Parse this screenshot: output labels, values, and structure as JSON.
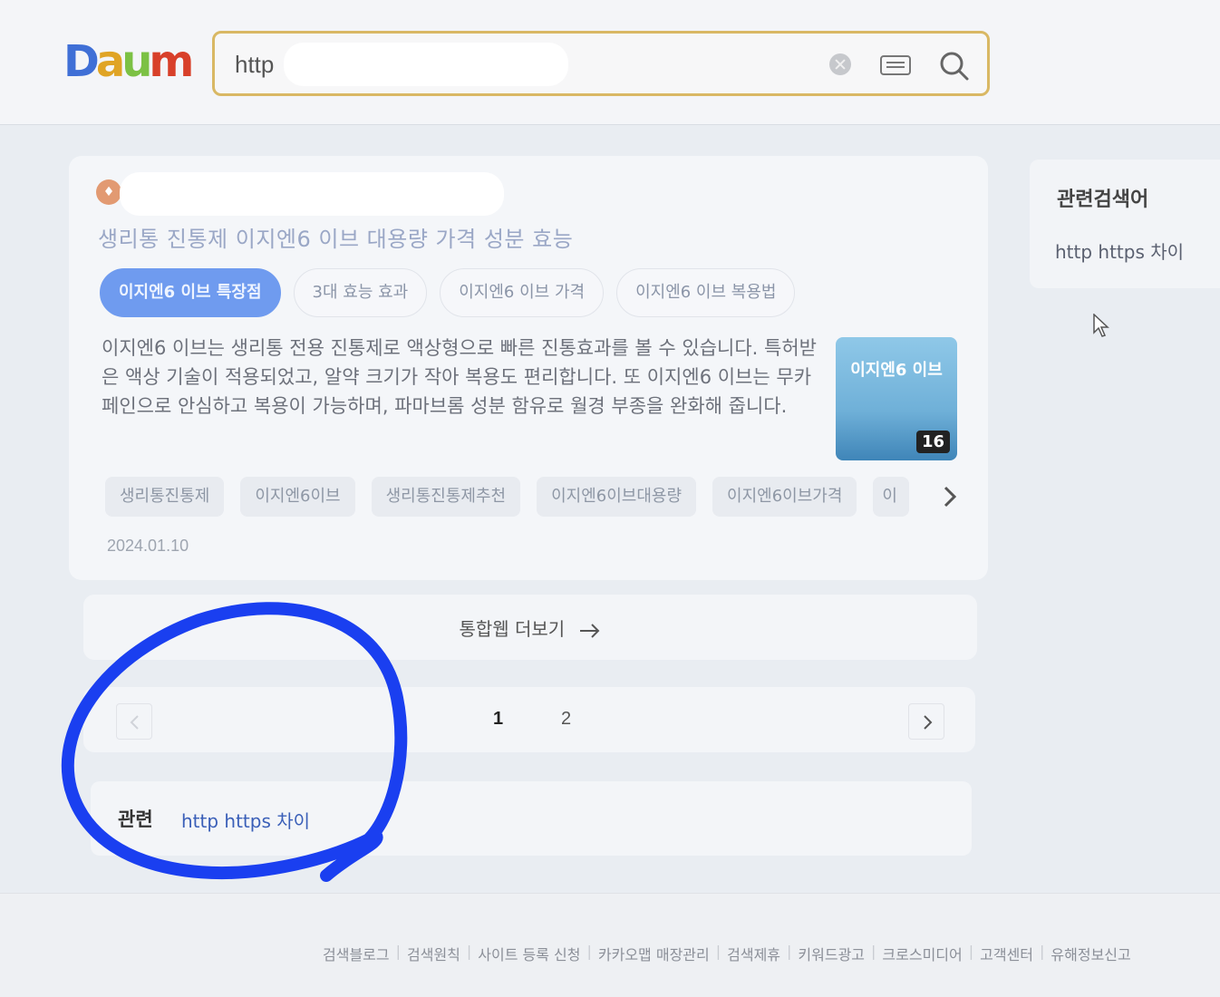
{
  "header": {
    "logo": [
      "D",
      "a",
      "u",
      "m"
    ],
    "search": {
      "value": "http"
    }
  },
  "result": {
    "title": "생리통 진통제 이지엔6 이브 대용량 가격 성분 효능",
    "chips": [
      "이지엔6 이브 특장점",
      "3대 효능 효과",
      "이지엔6 이브 가격",
      "이지엔6 이브 복용법"
    ],
    "active_chip": 0,
    "snippet": "이지엔6 이브는 생리통 전용 진통제로 액상형으로 빠른 진통효과를 볼 수 있습니다. 특허받은 액상 기술이 적용되었고, 알약 크기가 작아 복용도 편리합니다. 또 이지엔6 이브는 무카페인으로 안심하고 복용이 가능하며, 파마브롬 성분 함유로 월경 부종을 완화해 줍니다.",
    "thumbnail": {
      "title": "이지엔6 이브",
      "count": "16"
    },
    "tags": [
      "생리통진통제",
      "이지엔6이브",
      "생리통진통제추천",
      "이지엔6이브대용량",
      "이지엔6이브가격",
      "이"
    ],
    "date": "2024.01.10"
  },
  "more_results": {
    "label": "통합웹 더보기"
  },
  "pagination": {
    "pages": [
      "1",
      "2"
    ],
    "current": "1"
  },
  "related_bottom": {
    "label": "관련",
    "link": "http https 차이"
  },
  "sidebar": {
    "title": "관련검색어",
    "items": [
      "http https 차이"
    ]
  },
  "footer": {
    "links": [
      "검색블로그",
      "검색원칙",
      "사이트 등록 신청",
      "카카오맵 매장관리",
      "검색제휴",
      "키워드광고",
      "크로스미디어",
      "고객센터",
      "유해정보신고"
    ]
  },
  "colors": {
    "accent_chip": "#6f9bef",
    "search_border": "#d9b864",
    "annotation": "#1a3ff0"
  }
}
